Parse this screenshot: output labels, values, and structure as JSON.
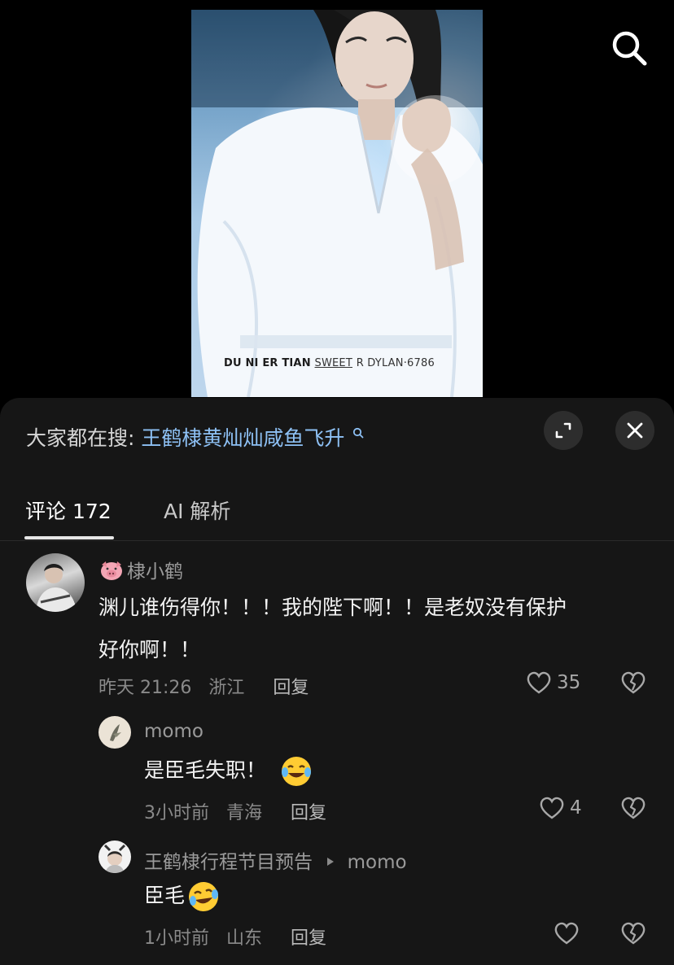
{
  "video": {
    "watermark_left": "DU NI ER TIAN",
    "watermark_mid": "SWEET",
    "watermark_tail": "R DYLAN·6786"
  },
  "topbar": {
    "search_icon": "search-icon"
  },
  "hot_search": {
    "label": "大家都在搜:",
    "term": "王鹤棣黄灿灿咸鱼飞升"
  },
  "actions": {
    "expand_icon": "expand-icon",
    "close_icon": "close-icon"
  },
  "tabs": [
    {
      "label": "评论 172",
      "active": true
    },
    {
      "label": "AI 解析",
      "active": false
    }
  ],
  "comments": [
    {
      "username": "棣小鹤",
      "badge": "pig-emoji",
      "text_line1": "渊儿谁伤得你！！！我的陛下啊！！是老奴没有保护",
      "text_line2": "好你啊！！",
      "time": "昨天 21:26",
      "location": "浙江",
      "reply": "回复",
      "likes": "35"
    },
    {
      "username": "momo",
      "text": "是臣毛失职！",
      "emoji": "tears-of-joy-emoji",
      "time": "3小时前",
      "location": "青海",
      "reply": "回复",
      "likes": "4"
    },
    {
      "username": "王鹤棣行程节目预告",
      "reply_to": "momo",
      "text": "臣毛",
      "emoji": "crying-laughing-emoji",
      "time": "1小时前",
      "location": "山东",
      "reply": "回复"
    }
  ],
  "colors": {
    "panel_bg": "#161616",
    "link_blue": "#8ec1f5",
    "muted_text": "#8a8a8a"
  }
}
